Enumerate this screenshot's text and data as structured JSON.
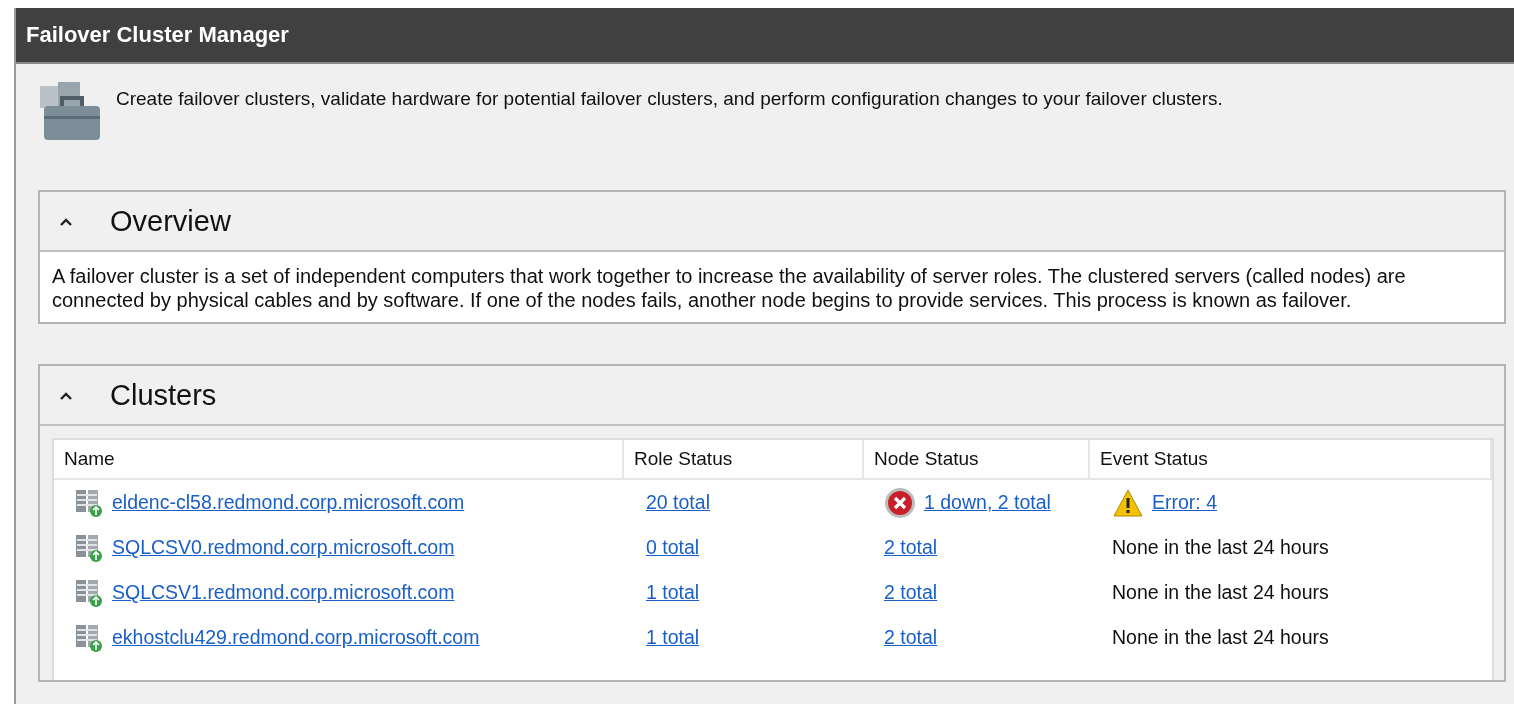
{
  "window": {
    "title": "Failover Cluster Manager"
  },
  "intro": {
    "text": "Create failover clusters, validate hardware for potential failover clusters, and perform configuration changes to your failover clusters."
  },
  "overview": {
    "title": "Overview",
    "expanded": true,
    "text": "A failover cluster is a set of independent computers that work together to increase the availability of server roles. The clustered servers (called nodes) are connected by physical cables and by software. If one of the nodes fails, another node begins to provide services. This process is known as failover."
  },
  "clusters": {
    "title": "Clusters",
    "expanded": true,
    "columns": [
      "Name",
      "Role Status",
      "Node Status",
      "Event Status"
    ],
    "rows": [
      {
        "name": "eldenc-cl58.redmond.corp.microsoft.com",
        "role_status": {
          "text": "20 total",
          "kind": "link"
        },
        "node_status": {
          "text": "1 down, 2 total",
          "kind": "error-link"
        },
        "event_status": {
          "text": "Error: 4",
          "kind": "warning-link"
        }
      },
      {
        "name": "SQLCSV0.redmond.corp.microsoft.com",
        "role_status": {
          "text": "0 total",
          "kind": "link"
        },
        "node_status": {
          "text": "2 total",
          "kind": "link"
        },
        "event_status": {
          "text": "None in the last 24 hours",
          "kind": "text"
        }
      },
      {
        "name": "SQLCSV1.redmond.corp.microsoft.com",
        "role_status": {
          "text": "1 total",
          "kind": "link"
        },
        "node_status": {
          "text": "2 total",
          "kind": "link"
        },
        "event_status": {
          "text": "None in the last 24 hours",
          "kind": "text"
        }
      },
      {
        "name": "ekhostclu429.redmond.corp.microsoft.com",
        "role_status": {
          "text": "1 total",
          "kind": "link"
        },
        "node_status": {
          "text": "2 total",
          "kind": "link"
        },
        "event_status": {
          "text": "None in the last 24 hours",
          "kind": "text"
        }
      }
    ]
  }
}
